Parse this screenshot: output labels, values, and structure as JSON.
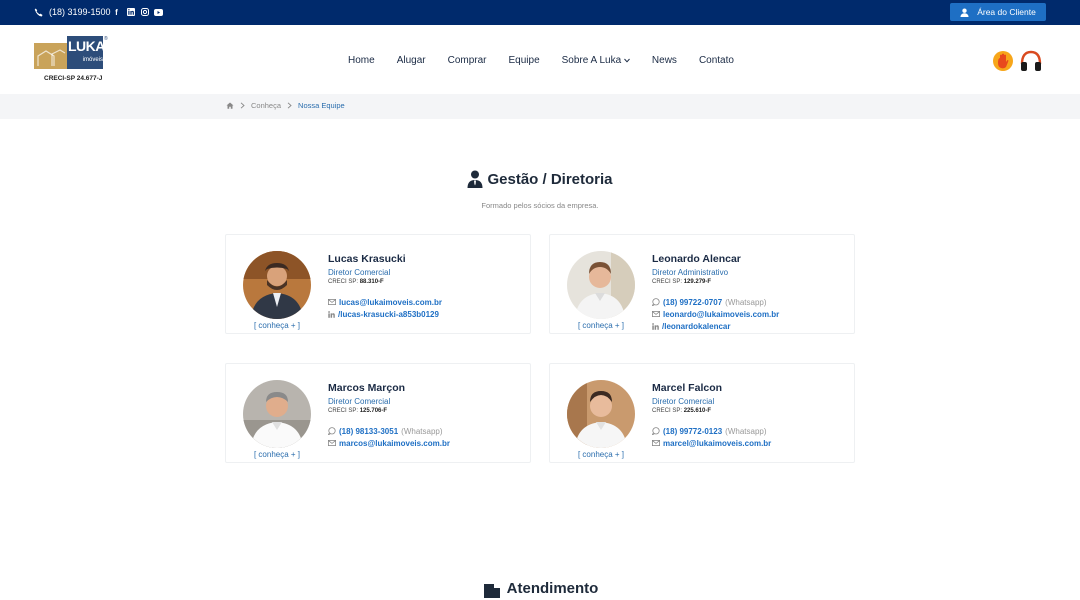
{
  "topbar": {
    "phone": "(18) 3199-1500",
    "area_button": "Área do Cliente",
    "social_icons": [
      "facebook-icon",
      "linkedin-icon",
      "instagram-icon",
      "youtube-icon"
    ]
  },
  "header": {
    "logo_name": "LUKA",
    "logo_subtitle": "imóveis",
    "logo_creci": "CRECI-SP 24.677-J",
    "nav": [
      "Home",
      "Alugar",
      "Comprar",
      "Equipe",
      "Sobre A Luka",
      "News",
      "Contato"
    ]
  },
  "breadcrumb": {
    "items": [
      "Conheça",
      "Nossa Equipe"
    ]
  },
  "gestao": {
    "title": "Gestão / Diretoria",
    "subtitle": "Formado pelos sócios da empresa."
  },
  "cards": [
    {
      "name": "Lucas Krasucki",
      "role": "Diretor Comercial",
      "creci_label": "CRECI SP:",
      "creci": "88.310-F",
      "email": "lucas@lukaimoveis.com.br",
      "linkedin": "/lucas-krasucki-a853b0129",
      "conheca": "[ conheça + ]"
    },
    {
      "name": "Leonardo Alencar",
      "role": "Diretor Administrativo",
      "creci_label": "CRECI SP:",
      "creci": "129.279-F",
      "phone": "(18) 99722-0707",
      "phone_tag": "(Whatsapp)",
      "email": "leonardo@lukaimoveis.com.br",
      "linkedin": "/leonardokalencar",
      "conheca": "[ conheça + ]"
    },
    {
      "name": "Marcos Marçon",
      "role": "Diretor Comercial",
      "creci_label": "CRECI SP:",
      "creci": "125.706-F",
      "phone": "(18) 98133-3051",
      "phone_tag": "(Whatsapp)",
      "email": "marcos@lukaimoveis.com.br",
      "conheca": "[ conheça + ]"
    },
    {
      "name": "Marcel Falcon",
      "role": "Diretor Comercial",
      "creci_label": "CRECI SP:",
      "creci": "225.610-F",
      "phone": "(18) 99772-0123",
      "phone_tag": "(Whatsapp)",
      "email": "marcel@lukaimoveis.com.br",
      "conheca": "[ conheça + ]"
    }
  ],
  "atendimento": {
    "title": "Atendimento"
  },
  "colors": {
    "topbar": "#002a6c",
    "accent": "#1e6fc4",
    "link": "#2a6dad"
  }
}
